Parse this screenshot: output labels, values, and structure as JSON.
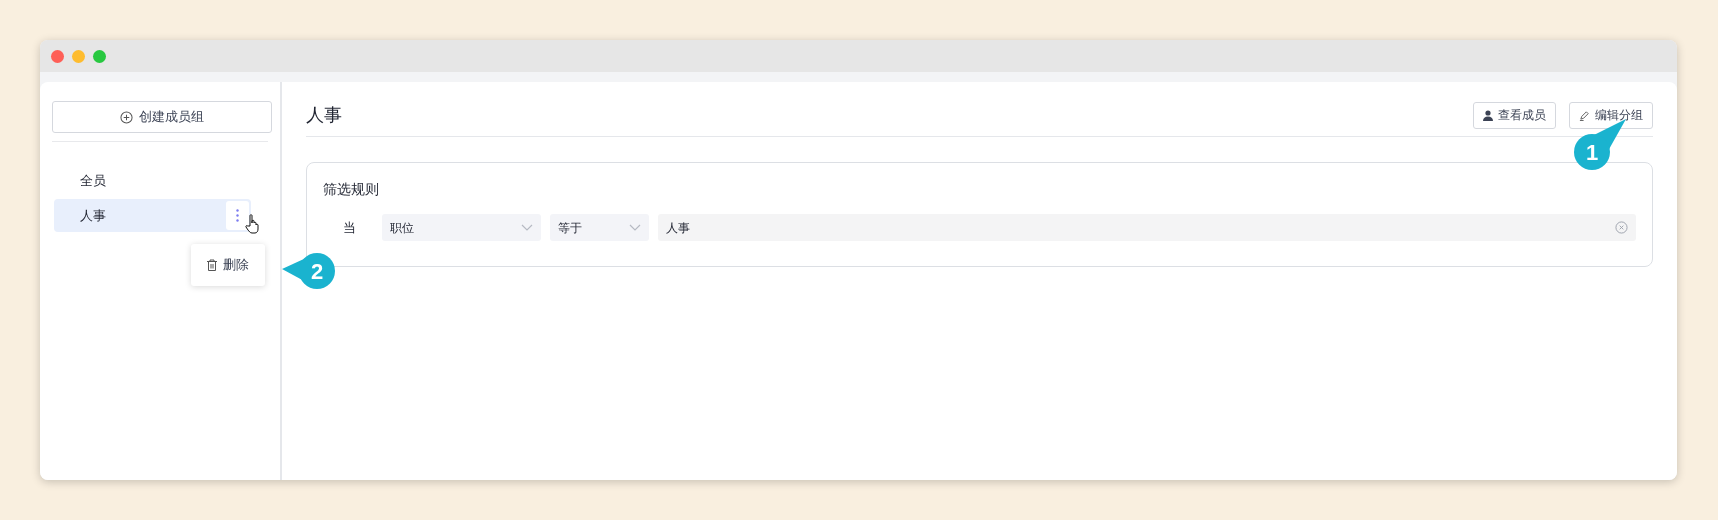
{
  "sidebar": {
    "create_button": "创建成员组",
    "groups": [
      {
        "label": "全员",
        "selected": false
      },
      {
        "label": "人事",
        "selected": true
      }
    ],
    "context_menu": {
      "items": [
        "删除"
      ]
    }
  },
  "main": {
    "title": "人事",
    "buttons": [
      {
        "kind": "members",
        "label": "查看成员"
      },
      {
        "kind": "edit",
        "label": "编辑分组"
      }
    ],
    "filter": {
      "title": "筛选规则",
      "condition_label": "当",
      "field": "职位",
      "operator": "等于",
      "value": "人事"
    }
  },
  "callouts": [
    {
      "number": "1"
    },
    {
      "number": "2"
    }
  ]
}
